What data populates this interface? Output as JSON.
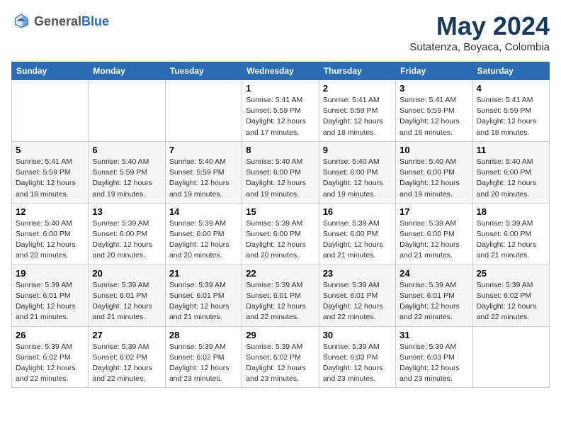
{
  "header": {
    "logo_general": "General",
    "logo_blue": "Blue",
    "month_title": "May 2024",
    "location": "Sutatenza, Boyaca, Colombia"
  },
  "days_of_week": [
    "Sunday",
    "Monday",
    "Tuesday",
    "Wednesday",
    "Thursday",
    "Friday",
    "Saturday"
  ],
  "weeks": [
    [
      {
        "day": "",
        "info": ""
      },
      {
        "day": "",
        "info": ""
      },
      {
        "day": "",
        "info": ""
      },
      {
        "day": "1",
        "info": "Sunrise: 5:41 AM\nSunset: 5:59 PM\nDaylight: 12 hours\nand 17 minutes."
      },
      {
        "day": "2",
        "info": "Sunrise: 5:41 AM\nSunset: 5:59 PM\nDaylight: 12 hours\nand 18 minutes."
      },
      {
        "day": "3",
        "info": "Sunrise: 5:41 AM\nSunset: 5:59 PM\nDaylight: 12 hours\nand 18 minutes."
      },
      {
        "day": "4",
        "info": "Sunrise: 5:41 AM\nSunset: 5:59 PM\nDaylight: 12 hours\nand 18 minutes."
      }
    ],
    [
      {
        "day": "5",
        "info": "Sunrise: 5:41 AM\nSunset: 5:59 PM\nDaylight: 12 hours\nand 18 minutes."
      },
      {
        "day": "6",
        "info": "Sunrise: 5:40 AM\nSunset: 5:59 PM\nDaylight: 12 hours\nand 19 minutes."
      },
      {
        "day": "7",
        "info": "Sunrise: 5:40 AM\nSunset: 5:59 PM\nDaylight: 12 hours\nand 19 minutes."
      },
      {
        "day": "8",
        "info": "Sunrise: 5:40 AM\nSunset: 6:00 PM\nDaylight: 12 hours\nand 19 minutes."
      },
      {
        "day": "9",
        "info": "Sunrise: 5:40 AM\nSunset: 6:00 PM\nDaylight: 12 hours\nand 19 minutes."
      },
      {
        "day": "10",
        "info": "Sunrise: 5:40 AM\nSunset: 6:00 PM\nDaylight: 12 hours\nand 19 minutes."
      },
      {
        "day": "11",
        "info": "Sunrise: 5:40 AM\nSunset: 6:00 PM\nDaylight: 12 hours\nand 20 minutes."
      }
    ],
    [
      {
        "day": "12",
        "info": "Sunrise: 5:40 AM\nSunset: 6:00 PM\nDaylight: 12 hours\nand 20 minutes."
      },
      {
        "day": "13",
        "info": "Sunrise: 5:39 AM\nSunset: 6:00 PM\nDaylight: 12 hours\nand 20 minutes."
      },
      {
        "day": "14",
        "info": "Sunrise: 5:39 AM\nSunset: 6:00 PM\nDaylight: 12 hours\nand 20 minutes."
      },
      {
        "day": "15",
        "info": "Sunrise: 5:39 AM\nSunset: 6:00 PM\nDaylight: 12 hours\nand 20 minutes."
      },
      {
        "day": "16",
        "info": "Sunrise: 5:39 AM\nSunset: 6:00 PM\nDaylight: 12 hours\nand 21 minutes."
      },
      {
        "day": "17",
        "info": "Sunrise: 5:39 AM\nSunset: 6:00 PM\nDaylight: 12 hours\nand 21 minutes."
      },
      {
        "day": "18",
        "info": "Sunrise: 5:39 AM\nSunset: 6:00 PM\nDaylight: 12 hours\nand 21 minutes."
      }
    ],
    [
      {
        "day": "19",
        "info": "Sunrise: 5:39 AM\nSunset: 6:01 PM\nDaylight: 12 hours\nand 21 minutes."
      },
      {
        "day": "20",
        "info": "Sunrise: 5:39 AM\nSunset: 6:01 PM\nDaylight: 12 hours\nand 21 minutes."
      },
      {
        "day": "21",
        "info": "Sunrise: 5:39 AM\nSunset: 6:01 PM\nDaylight: 12 hours\nand 21 minutes."
      },
      {
        "day": "22",
        "info": "Sunrise: 5:39 AM\nSunset: 6:01 PM\nDaylight: 12 hours\nand 22 minutes."
      },
      {
        "day": "23",
        "info": "Sunrise: 5:39 AM\nSunset: 6:01 PM\nDaylight: 12 hours\nand 22 minutes."
      },
      {
        "day": "24",
        "info": "Sunrise: 5:39 AM\nSunset: 6:01 PM\nDaylight: 12 hours\nand 22 minutes."
      },
      {
        "day": "25",
        "info": "Sunrise: 5:39 AM\nSunset: 6:02 PM\nDaylight: 12 hours\nand 22 minutes."
      }
    ],
    [
      {
        "day": "26",
        "info": "Sunrise: 5:39 AM\nSunset: 6:02 PM\nDaylight: 12 hours\nand 22 minutes."
      },
      {
        "day": "27",
        "info": "Sunrise: 5:39 AM\nSunset: 6:02 PM\nDaylight: 12 hours\nand 22 minutes."
      },
      {
        "day": "28",
        "info": "Sunrise: 5:39 AM\nSunset: 6:02 PM\nDaylight: 12 hours\nand 23 minutes."
      },
      {
        "day": "29",
        "info": "Sunrise: 5:39 AM\nSunset: 6:02 PM\nDaylight: 12 hours\nand 23 minutes."
      },
      {
        "day": "30",
        "info": "Sunrise: 5:39 AM\nSunset: 6:03 PM\nDaylight: 12 hours\nand 23 minutes."
      },
      {
        "day": "31",
        "info": "Sunrise: 5:39 AM\nSunset: 6:03 PM\nDaylight: 12 hours\nand 23 minutes."
      },
      {
        "day": "",
        "info": ""
      }
    ]
  ]
}
